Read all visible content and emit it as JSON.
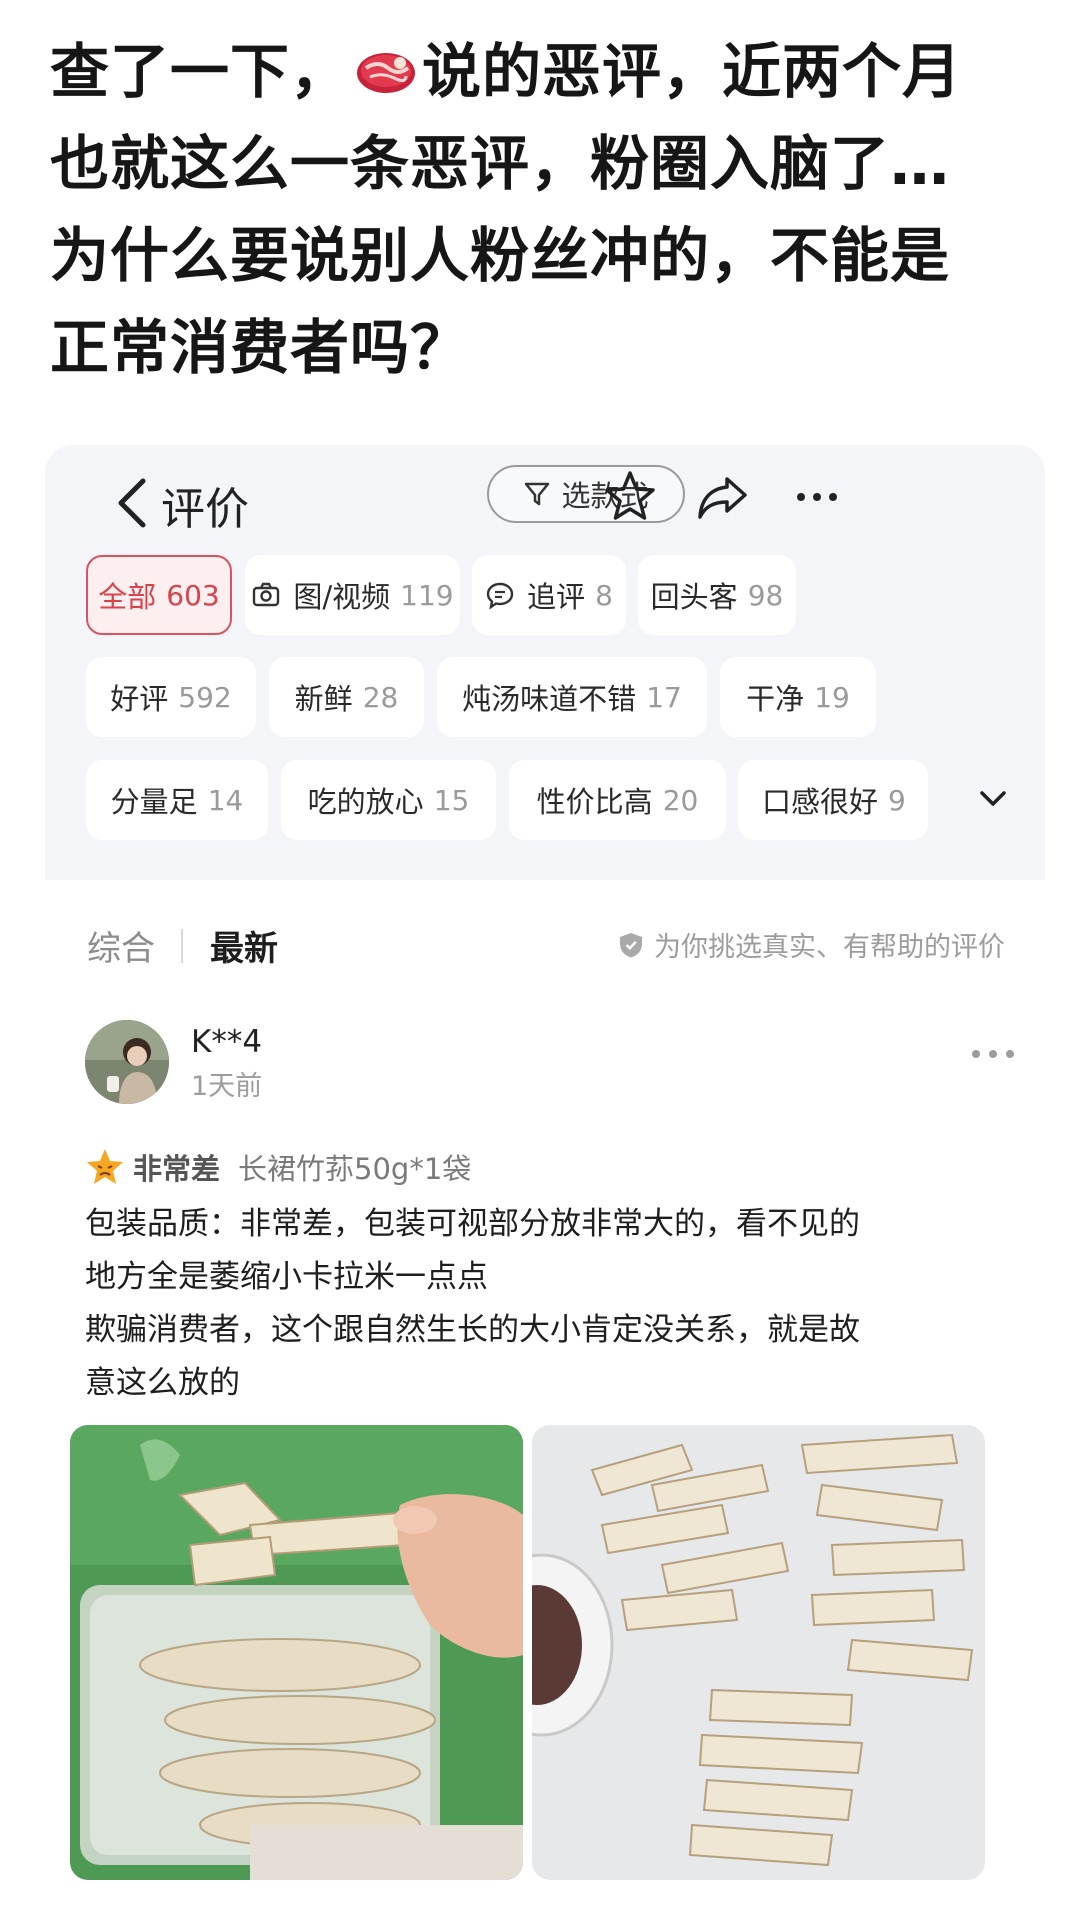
{
  "post": {
    "title_lines": [
      "查了一下，",
      "说的恶评，近两个月",
      "也就这么一条恶评，粉圈入脑了…",
      "为什么要说别人粉丝冲的，不能是",
      "正常消费者吗？"
    ],
    "emoji": "meat-icon"
  },
  "nav": {
    "title": "评价",
    "filter_label": "选款式",
    "icons": [
      "back-chevron-icon",
      "filter-icon",
      "star-icon",
      "share-icon",
      "more-icon"
    ]
  },
  "tags": [
    {
      "label": "全部",
      "count": "603",
      "active": true
    },
    {
      "label": "图/视频",
      "count": "119",
      "icon": "camera-icon"
    },
    {
      "label": "追评",
      "count": "8",
      "icon": "comment-icon"
    },
    {
      "label": "回头客",
      "count": "98"
    },
    {
      "label": "好评",
      "count": "592"
    },
    {
      "label": "新鲜",
      "count": "28"
    },
    {
      "label": "炖汤味道不错",
      "count": "17"
    },
    {
      "label": "干净",
      "count": "19"
    },
    {
      "label": "分量足",
      "count": "14"
    },
    {
      "label": "吃的放心",
      "count": "15"
    },
    {
      "label": "性价比高",
      "count": "20"
    },
    {
      "label": "口感很好",
      "count": "9"
    }
  ],
  "sort": {
    "options": [
      "综合",
      "最新"
    ],
    "selected": "最新",
    "hint": "为你挑选真实、有帮助的评价"
  },
  "review": {
    "user": "K**4",
    "time": "1天前",
    "rating": "非常差",
    "spec": "长裙竹荪50g*1袋",
    "body_lines": [
      "包装品质：非常差，包装可视部分放非常大的，看不见的",
      "地方全是萎缩小卡拉米一点点",
      "欺骗消费者，这个跟自然生长的大小肯定没关系，就是故",
      "意这么放的"
    ],
    "photos": [
      "bamboo-fungus-in-bag",
      "bamboo-fungus-on-table"
    ]
  },
  "colors": {
    "accent": "#d8424b",
    "tag_bg": "#ffffff",
    "panel_bg": "#f4f5f8"
  }
}
